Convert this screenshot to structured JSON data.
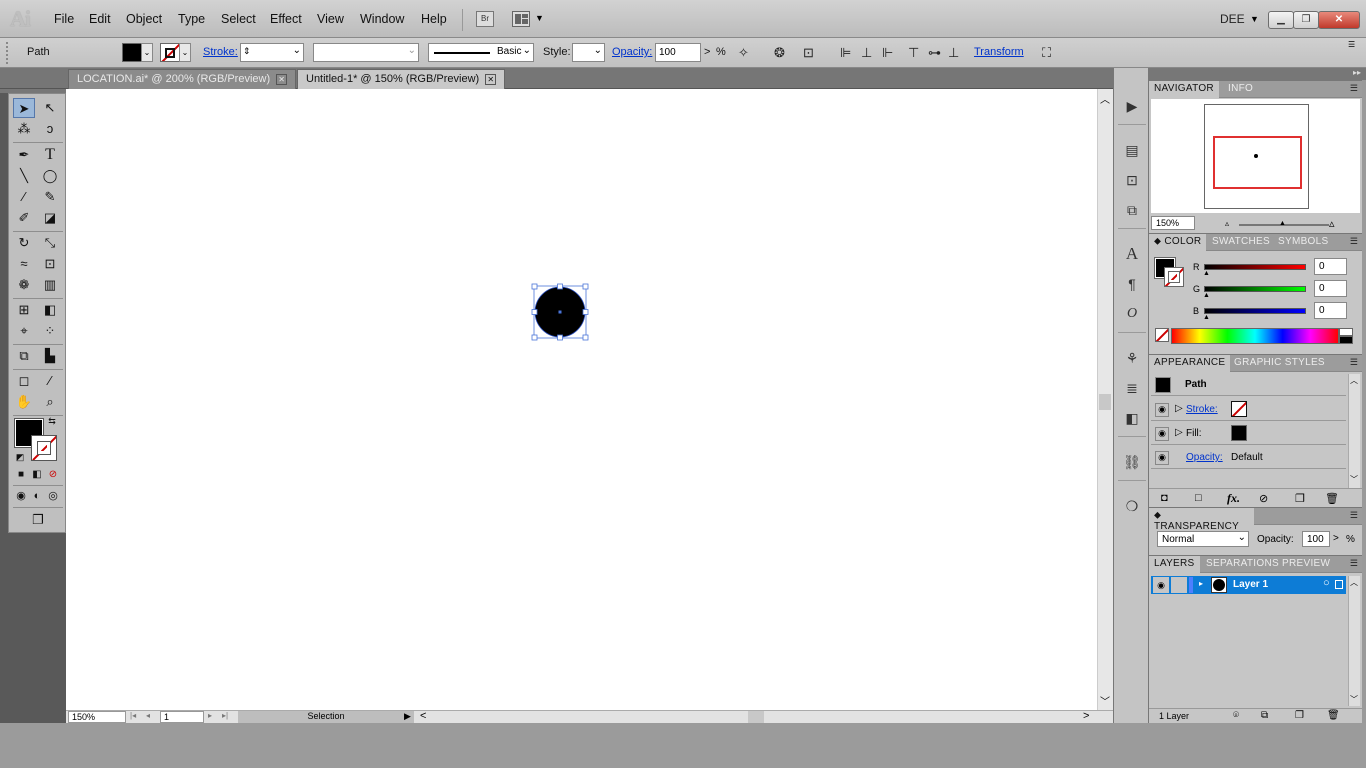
{
  "app": {
    "logo": "Ai",
    "user": "DEE",
    "user_caret": "▼"
  },
  "menu": [
    "File",
    "Edit",
    "Object",
    "Type",
    "Select",
    "Effect",
    "View",
    "Window",
    "Help"
  ],
  "menubar_buttons": {
    "bridge": "Br",
    "arrange_caret": "▼"
  },
  "window_controls": {
    "minimize": "▁",
    "restore": "❐",
    "close": "✕"
  },
  "control_bar": {
    "selection_type": "Path",
    "stroke_label": "Stroke:",
    "stroke_spinner": "⇕",
    "brush_label": "Basic",
    "style_label": "Style:",
    "opacity_label": "Opacity:",
    "opacity_value": "100",
    "opacity_arrow": ">",
    "opacity_unit": "%",
    "transform_label": "Transform",
    "dropdown_glyph": "⌄"
  },
  "tabs": [
    {
      "label": "LOCATION.ai* @ 200% (RGB/Preview)",
      "active": false,
      "close": "✕"
    },
    {
      "label": "Untitled-1* @ 150% (RGB/Preview)",
      "active": true,
      "close": "✕"
    }
  ],
  "tool_glyphs": {
    "selection": "➤",
    "direct_selection": "↖",
    "magic_wand": "⁂",
    "lasso": "ↄ",
    "pen": "✒",
    "type": "T",
    "line": "╲",
    "ellipse": "◯",
    "paintbrush": "∕",
    "pencil": "✎",
    "blob": "✐",
    "eraser": "◪",
    "rotate": "↻",
    "scale": "⤡",
    "warp": "≈",
    "free_transform": "⊡",
    "symbol": "❁",
    "graph": "▥",
    "mesh": "⊞",
    "gradient": "◧",
    "eyedropper": "⌖",
    "blend": "⁘",
    "slice": "⧉",
    "column_graph": "▙",
    "artboard": "◻",
    "knife": "⁄",
    "hand": "✋",
    "zoom": "⌕",
    "swap": "⇆",
    "default": "◩",
    "mode_fill": "■",
    "mode_grad": "◧",
    "mode_none": "⊘",
    "draw_normal": "◉",
    "draw_behind": "◐",
    "draw_inside": "◎",
    "screen_mode": "❐",
    "panel_collapse": "◂◂",
    "dock_collapse": "◂◂",
    "panel_expand": "▸▸"
  },
  "status": {
    "zoom": "150%",
    "artboard": "1",
    "mode": "Selection",
    "first": "|◂",
    "prev": "◂",
    "next": "▸",
    "last": "▸|",
    "play": "▶",
    "scroll_left": "<",
    "scroll_right": ">",
    "scroll_up": "︿",
    "scroll_down": "﹀"
  },
  "dock_glyphs": [
    "▶",
    "▤",
    "⊡",
    "⧉",
    "A",
    "¶",
    "O",
    "⚘",
    "≣",
    "◧",
    "⛓",
    "❍"
  ],
  "navigator": {
    "tabs": [
      "NAVIGATOR",
      "INFO"
    ],
    "zoom": "150%",
    "menu": "☰"
  },
  "color_panel": {
    "tabs": [
      "COLOR",
      "SWATCHES",
      "SYMBOLS"
    ],
    "channels": [
      {
        "label": "R",
        "value": "0"
      },
      {
        "label": "G",
        "value": "0"
      },
      {
        "label": "B",
        "value": "0"
      }
    ]
  },
  "appearance": {
    "tabs": [
      "APPEARANCE",
      "GRAPHIC STYLES"
    ],
    "title": "Path",
    "rows": [
      {
        "label": "Stroke:",
        "link": true
      },
      {
        "label": "Fill:",
        "link": false
      },
      {
        "label": "Opacity:",
        "value": "Default",
        "link": true
      }
    ],
    "footer_fx": "fx."
  },
  "transparency": {
    "title": "TRANSPARENCY",
    "blend_mode": "Normal",
    "opacity_label": "Opacity:",
    "opacity_value": "100",
    "arrow": ">",
    "unit": "%"
  },
  "layers": {
    "tabs": [
      "LAYERS",
      "SEPARATIONS PREVIEW"
    ],
    "items": [
      {
        "name": "Layer 1"
      }
    ],
    "footer": "1 Layer"
  },
  "colors": {
    "accent": "#0d7cd6",
    "link": "#0033cc",
    "swatch_red": "#cc0000"
  }
}
